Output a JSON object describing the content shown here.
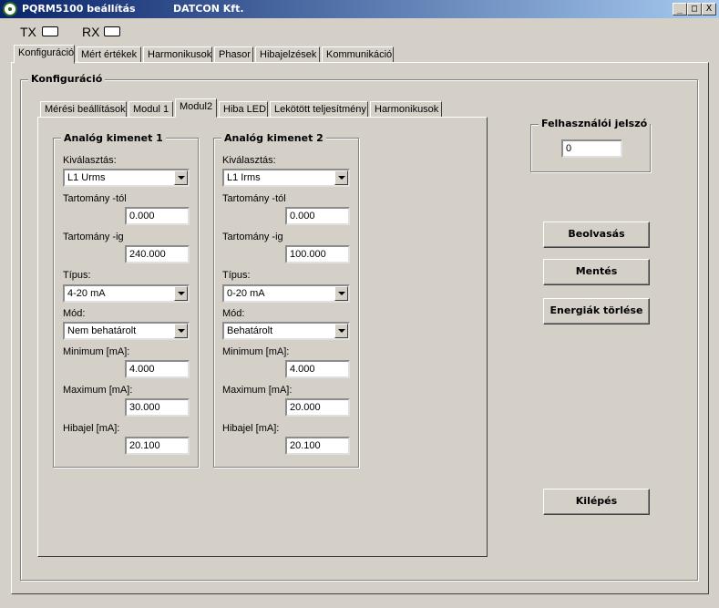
{
  "window": {
    "title": "PQRM5100 beállítás",
    "company": "DATCON Kft.",
    "controls": {
      "minimize": "_",
      "maximize": "□",
      "close": "X"
    }
  },
  "indicators": {
    "tx": "TX",
    "rx": "RX"
  },
  "main_tabs": [
    "Konfiguráció",
    "Mért értékek",
    "Harmonikusok",
    "Phasor",
    "Hibajelzések",
    "Kommunikáció"
  ],
  "config_group_label": "Konfiguráció",
  "sub_tabs": [
    "Mérési beállítások",
    "Modul 1",
    "Modul2",
    "Hiba LED",
    "Lekötött teljesítmény",
    "Harmonikusok"
  ],
  "labels": {
    "select": "Kiválasztás:",
    "range_from": "Tartomány -tól",
    "range_to": "Tartomány -ig",
    "type": "Típus:",
    "mode": "Mód:",
    "minimum": "Minimum [mA]:",
    "maximum": "Maximum [mA]:",
    "error": "Hibajel [mA]:"
  },
  "outputs": [
    {
      "title": "Analóg kimenet 1",
      "select": "L1 Urms",
      "from": "0.000",
      "to": "240.000",
      "type": "4-20 mA",
      "mode": "Nem behatárolt",
      "minimum": "4.000",
      "maximum": "30.000",
      "error": "20.100"
    },
    {
      "title": "Analóg kimenet 2",
      "select": "L1 Irms",
      "from": "0.000",
      "to": "100.000",
      "type": "0-20 mA",
      "mode": "Behatárolt",
      "minimum": "4.000",
      "maximum": "20.000",
      "error": "20.100"
    }
  ],
  "password": {
    "label": "Felhasználói jelszó",
    "value": "0"
  },
  "buttons": {
    "read": "Beolvasás",
    "save": "Mentés",
    "clear_energy": "Energiák törlése",
    "exit": "Kilépés"
  }
}
